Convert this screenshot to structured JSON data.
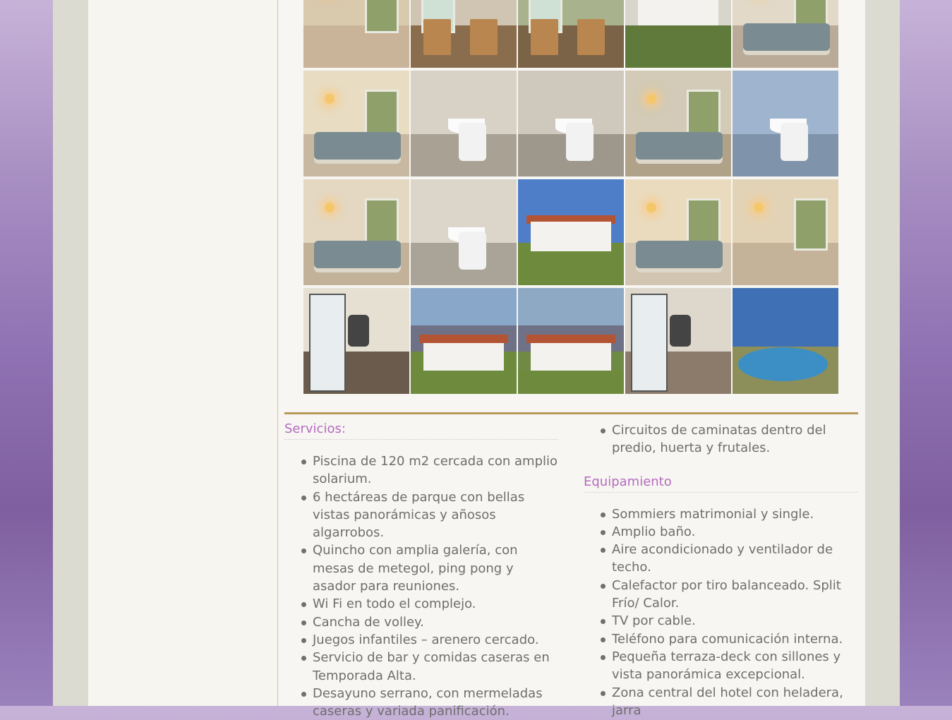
{
  "gallery": {
    "thumbs": [
      {
        "name": "thumb-hallway",
        "type": "interior",
        "bg": "#d9c9ad",
        "floor": "#c9b49a"
      },
      {
        "name": "thumb-deck-chairs",
        "type": "deck",
        "bg": "#cfc5b2",
        "floor": "#8a6d4d"
      },
      {
        "name": "thumb-deck-chairs-2",
        "type": "deck",
        "bg": "#a8b28c",
        "floor": "#7a6347"
      },
      {
        "name": "thumb-patio-lawn",
        "type": "exterior",
        "bg": "#d8d6cc",
        "floor": "#5f7a3b"
      },
      {
        "name": "thumb-twin-beds",
        "type": "bedroom",
        "bg": "#e2d9c8",
        "floor": "#b9ab97"
      },
      {
        "name": "thumb-room-beds",
        "type": "bedroom",
        "bg": "#e8dcc2",
        "floor": "#c9b8a1"
      },
      {
        "name": "thumb-bathroom-mirror",
        "type": "bathroom",
        "bg": "#d7d1c6",
        "floor": "#a9a294"
      },
      {
        "name": "thumb-bathroom-toilet",
        "type": "bathroom",
        "bg": "#cfc9bd",
        "floor": "#9d978c"
      },
      {
        "name": "thumb-bedroom-window",
        "type": "bedroom",
        "bg": "#d3cbb7",
        "floor": "#b0a189"
      },
      {
        "name": "thumb-bathroom-blue",
        "type": "bathroom",
        "bg": "#9fb4cf",
        "floor": "#7f93aa"
      },
      {
        "name": "thumb-bedroom-art",
        "type": "bedroom",
        "bg": "#e4d8c3",
        "floor": "#c2b29a"
      },
      {
        "name": "thumb-bathroom-shower",
        "type": "bathroom",
        "bg": "#dcd6ca",
        "floor": "#aaa398"
      },
      {
        "name": "thumb-exterior-house",
        "type": "house",
        "bg": "#4f7ec9",
        "floor": "#6e8a3c"
      },
      {
        "name": "thumb-bedroom-double",
        "type": "bedroom",
        "bg": "#eadbbf",
        "floor": "#d2c6b2"
      },
      {
        "name": "thumb-room-view",
        "type": "interior",
        "bg": "#e3d3b6",
        "floor": "#c4b299"
      },
      {
        "name": "thumb-kitchenette",
        "type": "kitchen",
        "bg": "#e6e0d3",
        "floor": "#6a5b4c"
      },
      {
        "name": "thumb-house-mountains",
        "type": "landscape",
        "bg": "#88a7c9",
        "floor": "#6e8a3c"
      },
      {
        "name": "thumb-house-mountains-2",
        "type": "landscape",
        "bg": "#8ea9c3",
        "floor": "#6f8a45"
      },
      {
        "name": "thumb-fridge-kitchen",
        "type": "kitchen",
        "bg": "#ddd7cc",
        "floor": "#8c7b6a"
      },
      {
        "name": "thumb-pool",
        "type": "pool",
        "bg": "#3f6fb5",
        "floor": "#8d8f5a"
      }
    ]
  },
  "servicios": {
    "title": "Servicios:",
    "items": [
      "Piscina de 120 m2 cercada con amplio solarium.",
      "6 hectáreas de parque con bellas vistas panorámicas y añosos algarrobos.",
      "Quincho con amplia galería, con mesas de metegol, ping pong y asador para reuniones.",
      "Wi Fi en todo el complejo.",
      "Cancha de volley.",
      "Juegos infantiles – arenero cercado.",
      "Servicio de bar y comidas caseras en Temporada Alta.",
      "Desayuno serrano, con mermeladas caseras y variada panificación."
    ],
    "continued": [
      "Circuitos de caminatas dentro del predio, huerta y frutales."
    ]
  },
  "equipamiento": {
    "title": "Equipamiento",
    "items": [
      "Sommiers matrimonial y single.",
      "Amplio baño.",
      "Aire acondicionado y ventilador de techo.",
      "Calefactor por tiro balanceado. Split Frío/ Calor.",
      "TV por cable.",
      "Teléfono para comunicación interna.",
      "Pequeña terraza-deck con sillones y vista panorámica excepcional.",
      "Zona central del hotel con heladera, jarra"
    ]
  },
  "colors": {
    "accent": "#b56bbf",
    "rule": "#b89a57",
    "text": "#707070"
  }
}
